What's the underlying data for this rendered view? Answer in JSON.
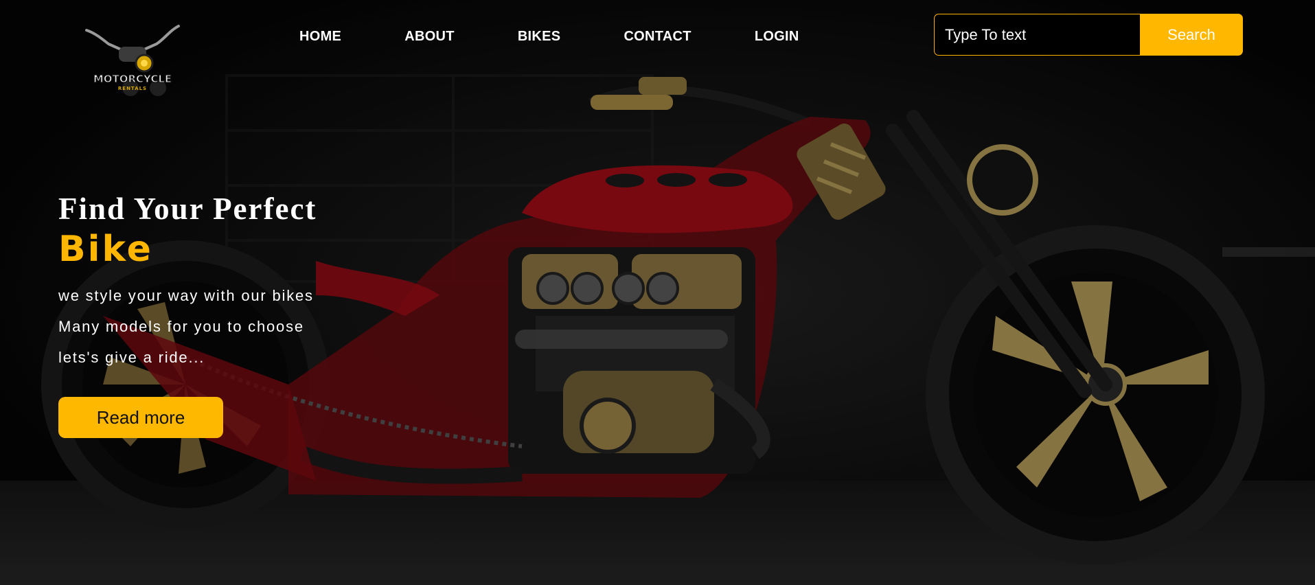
{
  "logo": {
    "line1": "MOTORCYCLE",
    "line2": "RENTALS"
  },
  "nav": {
    "items": [
      {
        "label": "HOME"
      },
      {
        "label": "ABOUT"
      },
      {
        "label": "BIKES"
      },
      {
        "label": "CONTACT"
      },
      {
        "label": "LOGIN"
      }
    ]
  },
  "search": {
    "placeholder": "Type To text",
    "button_label": "Search"
  },
  "hero": {
    "title_line1": "Find Your Perfect",
    "title_line2": "Bike",
    "lines": [
      "we style your way with our bikes",
      "Many models for you to choose",
      "lets's give a ride..."
    ],
    "cta_label": "Read more"
  },
  "colors": {
    "accent": "#ffb700",
    "background": "#050505",
    "bike_red": "#b0101a",
    "bike_gold": "#b9954a"
  }
}
